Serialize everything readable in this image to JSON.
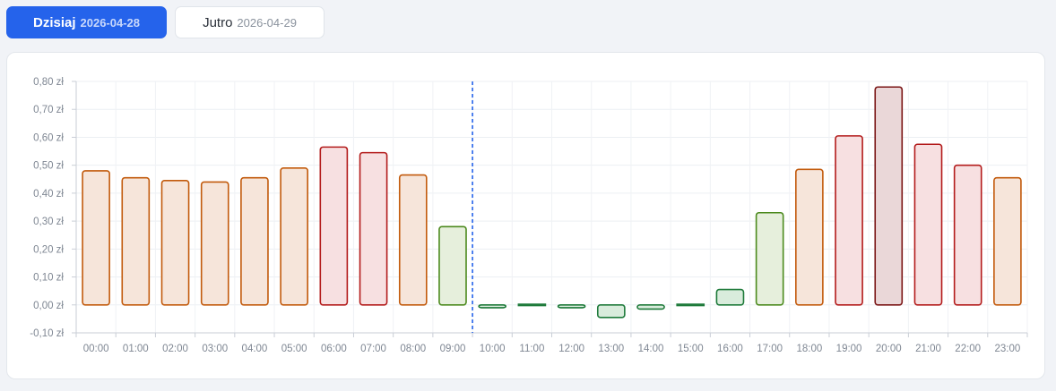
{
  "tabs": [
    {
      "label": "Dzisiaj",
      "date": "2026-04-28",
      "active": true
    },
    {
      "label": "Jutro",
      "date": "2026-04-29",
      "active": false
    }
  ],
  "colors": {
    "accent": "#2563eb",
    "high_stroke": "#b31b1b",
    "high_fill": "#f7e0e1",
    "peak_stroke": "#7a1515",
    "peak_fill": "#ead7d8",
    "mid_stroke": "#c25a0c",
    "mid_fill": "#f6e5da",
    "low_stroke": "#4c8a1e",
    "low_fill": "#e6efdc",
    "neg_stroke": "#1e7a3a",
    "neg_fill": "#d9ecdc",
    "now_line": "#2563eb"
  },
  "chart_data": {
    "type": "bar",
    "categories": [
      "00:00",
      "01:00",
      "02:00",
      "03:00",
      "04:00",
      "05:00",
      "06:00",
      "07:00",
      "08:00",
      "09:00",
      "10:00",
      "11:00",
      "12:00",
      "13:00",
      "14:00",
      "15:00",
      "16:00",
      "17:00",
      "18:00",
      "19:00",
      "20:00",
      "21:00",
      "22:00",
      "23:00"
    ],
    "values": [
      0.48,
      0.455,
      0.445,
      0.44,
      0.455,
      0.49,
      0.565,
      0.545,
      0.465,
      0.28,
      -0.01,
      0.0,
      -0.01,
      -0.045,
      -0.015,
      0.0,
      0.055,
      0.33,
      0.485,
      0.605,
      0.78,
      0.575,
      0.5,
      0.455
    ],
    "ylim": [
      -0.1,
      0.8
    ],
    "yticks": [
      "-0,10 zł",
      "0,00 zł",
      "0,10 zł",
      "0,20 zł",
      "0,30 zł",
      "0,40 zł",
      "0,50 zł",
      "0,60 zł",
      "0,70 zł",
      "0,80 zł"
    ],
    "current_hour": "10:00",
    "grid": true
  }
}
